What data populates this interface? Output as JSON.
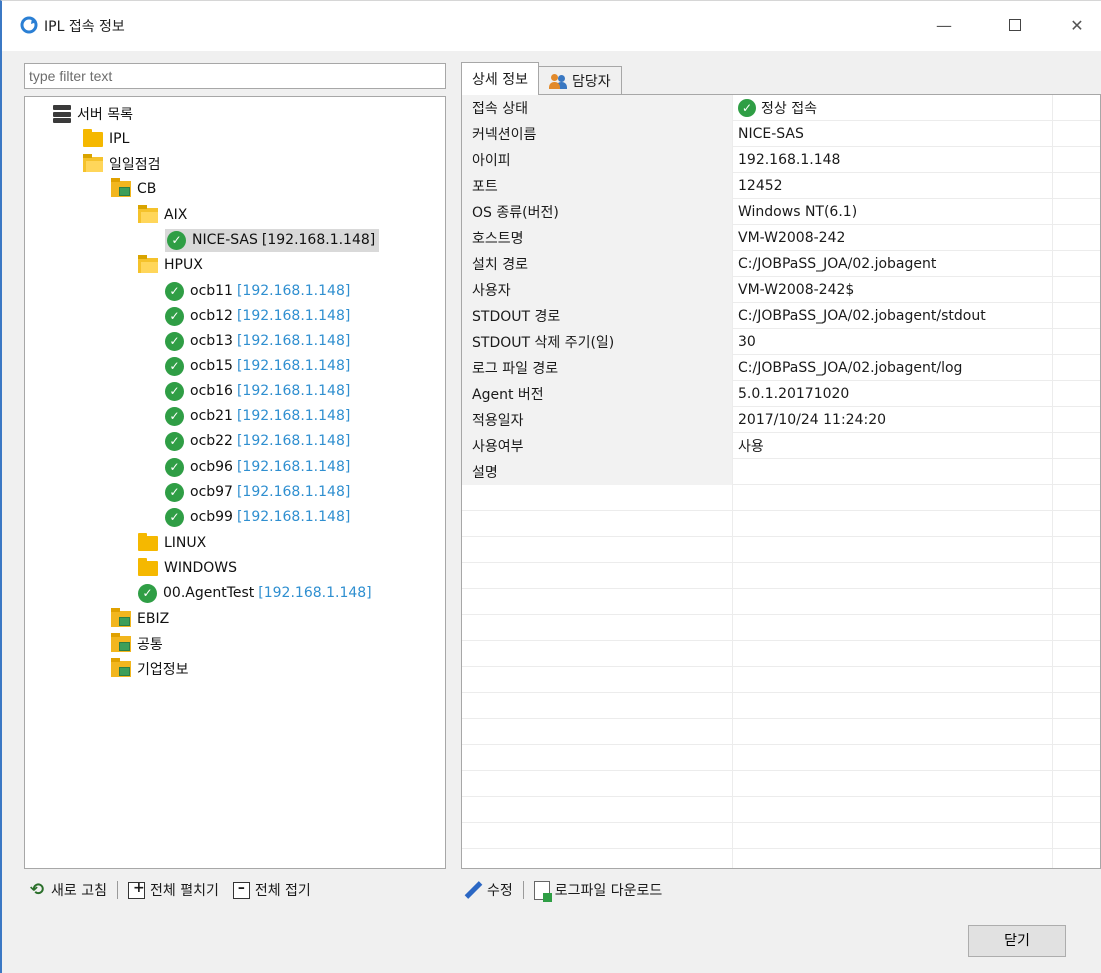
{
  "window": {
    "title": "IPL 접속 정보",
    "minimize": "—",
    "close": "✕"
  },
  "filter": {
    "placeholder": "type filter text",
    "value": ""
  },
  "tree": {
    "root": "서버 목록",
    "ipl": "IPL",
    "daily": "일일점검",
    "cb": "CB",
    "aix": "AIX",
    "selected": {
      "name": "NICE-SAS",
      "ip": "[192.168.1.148]"
    },
    "hpux": "HPUX",
    "hpux_items": [
      {
        "name": "ocb11",
        "ip": "[192.168.1.148]"
      },
      {
        "name": "ocb12",
        "ip": "[192.168.1.148]"
      },
      {
        "name": "ocb13",
        "ip": "[192.168.1.148]"
      },
      {
        "name": "ocb15",
        "ip": "[192.168.1.148]"
      },
      {
        "name": "ocb16",
        "ip": "[192.168.1.148]"
      },
      {
        "name": "ocb21",
        "ip": "[192.168.1.148]"
      },
      {
        "name": "ocb22",
        "ip": "[192.168.1.148]"
      },
      {
        "name": "ocb96",
        "ip": "[192.168.1.148]"
      },
      {
        "name": "ocb97",
        "ip": "[192.168.1.148]"
      },
      {
        "name": "ocb99",
        "ip": "[192.168.1.148]"
      }
    ],
    "linux": "LINUX",
    "windows": "WINDOWS",
    "agent_test": {
      "name": "00.AgentTest",
      "ip": "[192.168.1.148]"
    },
    "ebiz": "EBIZ",
    "common": "공통",
    "company": "기업정보"
  },
  "left_toolbar": {
    "refresh": "새로 고침",
    "expand_all": "전체 펼치기",
    "collapse_all": "전체 접기"
  },
  "tabs": {
    "detail": "상세 정보",
    "manager": "담당자"
  },
  "details": [
    {
      "key": "접속 상태",
      "value": "정상 접속"
    },
    {
      "key": "커넥션이름",
      "value": "NICE-SAS"
    },
    {
      "key": "아이피",
      "value": "192.168.1.148"
    },
    {
      "key": "포트",
      "value": "12452"
    },
    {
      "key": "OS 종류(버전)",
      "value": "Windows NT(6.1)"
    },
    {
      "key": "호스트명",
      "value": "VM-W2008-242"
    },
    {
      "key": "설치 경로",
      "value": "C:/JOBPaSS_JOA/02.jobagent"
    },
    {
      "key": "사용자",
      "value": "VM-W2008-242$"
    },
    {
      "key": "STDOUT 경로",
      "value": "C:/JOBPaSS_JOA/02.jobagent/stdout"
    },
    {
      "key": "STDOUT 삭제 주기(일)",
      "value": "30"
    },
    {
      "key": "로그 파일 경로",
      "value": "C:/JOBPaSS_JOA/02.jobagent/log"
    },
    {
      "key": "Agent 버전",
      "value": "5.0.1.20171020"
    },
    {
      "key": "적용일자",
      "value": "2017/10/24 11:24:20"
    },
    {
      "key": "사용여부",
      "value": "사용"
    },
    {
      "key": "설명",
      "value": ""
    }
  ],
  "right_toolbar": {
    "edit": "수정",
    "log_download": "로그파일 다운로드"
  },
  "close_button": "닫기",
  "colors": {
    "ip_link": "#2f8fd0",
    "status_ok": "#2f9e45",
    "folder": "#f5b800",
    "window_border": "#3b78c4"
  }
}
